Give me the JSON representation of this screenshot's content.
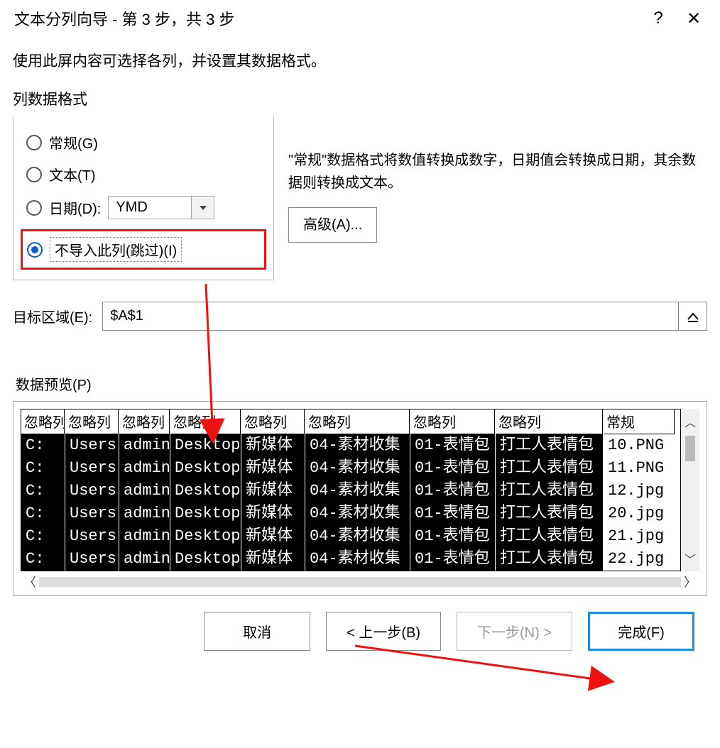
{
  "titlebar": {
    "title": "文本分列向导 - 第 3 步，共 3 步",
    "help": "?",
    "close": "✕"
  },
  "instruction": "使用此屏内容可选择各列，并设置其数据格式。",
  "format": {
    "group_label": "列数据格式",
    "general": "常规(G)",
    "text": "文本(T)",
    "date_prefix": "日期(D):",
    "date_value": "YMD",
    "skip": "不导入此列(跳过)(I)",
    "description": "\"常规\"数据格式将数值转换成数字，日期值会转换成日期，其余数据则转换成文本。",
    "advanced": "高级(A)..."
  },
  "destination": {
    "label": "目标区域(E):",
    "value": "$A$1"
  },
  "preview": {
    "label": "数据预览(P)",
    "columns": [
      {
        "header": "忽略列",
        "type": "skip",
        "width": 62,
        "cells": [
          "C:",
          "C:",
          "C:",
          "C:",
          "C:",
          "C:"
        ]
      },
      {
        "header": "忽略列",
        "type": "skip",
        "width": 76,
        "cells": [
          "Users",
          "Users",
          "Users",
          "Users",
          "Users",
          "Users"
        ]
      },
      {
        "header": "忽略列",
        "type": "skip",
        "width": 72,
        "cells": [
          "admin",
          "admin",
          "admin",
          "admin",
          "admin",
          "admin"
        ]
      },
      {
        "header": "忽略列",
        "type": "skip",
        "width": 100,
        "cells": [
          "Desktop",
          "Desktop",
          "Desktop",
          "Desktop",
          "Desktop",
          "Desktop"
        ]
      },
      {
        "header": "忽略列",
        "type": "skip",
        "width": 90,
        "cells": [
          "新媒体",
          "新媒体",
          "新媒体",
          "新媒体",
          "新媒体",
          "新媒体"
        ]
      },
      {
        "header": "忽略列",
        "type": "skip",
        "width": 148,
        "cells": [
          "04-素材收集",
          "04-素材收集",
          "04-素材收集",
          "04-素材收集",
          "04-素材收集",
          "04-素材收集"
        ]
      },
      {
        "header": "忽略列",
        "type": "skip",
        "width": 120,
        "cells": [
          "01-表情包",
          "01-表情包",
          "01-表情包",
          "01-表情包",
          "01-表情包",
          "01-表情包"
        ]
      },
      {
        "header": "忽略列",
        "type": "skip",
        "width": 152,
        "cells": [
          "打工人表情包",
          "打工人表情包",
          "打工人表情包",
          "打工人表情包",
          "打工人表情包",
          "打工人表情包"
        ]
      },
      {
        "header": "常规",
        "type": "normal",
        "width": 100,
        "cells": [
          "10.PNG",
          "11.PNG",
          "12.jpg",
          "20.jpg",
          "21.jpg",
          "22.jpg"
        ]
      }
    ]
  },
  "footer": {
    "cancel": "取消",
    "back": "< 上一步(B)",
    "next": "下一步(N) >",
    "finish": "完成(F)"
  }
}
